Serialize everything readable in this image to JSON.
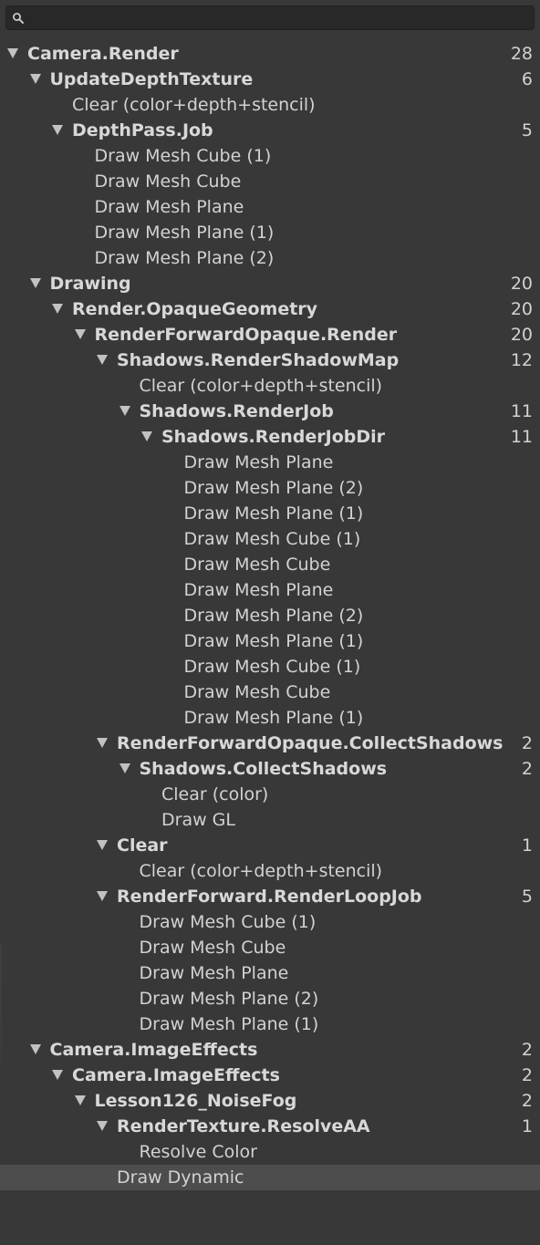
{
  "search": {
    "value": "",
    "placeholder": ""
  },
  "tree": [
    {
      "label": "Camera.Render",
      "count": "28",
      "depth": 0,
      "expandable": true
    },
    {
      "label": "UpdateDepthTexture",
      "count": "6",
      "depth": 1,
      "expandable": true
    },
    {
      "label": "Clear (color+depth+stencil)",
      "count": "",
      "depth": 2,
      "expandable": false
    },
    {
      "label": "DepthPass.Job",
      "count": "5",
      "depth": 2,
      "expandable": true
    },
    {
      "label": "Draw Mesh Cube (1)",
      "count": "",
      "depth": 3,
      "expandable": false
    },
    {
      "label": "Draw Mesh Cube",
      "count": "",
      "depth": 3,
      "expandable": false
    },
    {
      "label": "Draw Mesh Plane",
      "count": "",
      "depth": 3,
      "expandable": false
    },
    {
      "label": "Draw Mesh Plane (1)",
      "count": "",
      "depth": 3,
      "expandable": false
    },
    {
      "label": "Draw Mesh Plane (2)",
      "count": "",
      "depth": 3,
      "expandable": false
    },
    {
      "label": "Drawing",
      "count": "20",
      "depth": 1,
      "expandable": true
    },
    {
      "label": "Render.OpaqueGeometry",
      "count": "20",
      "depth": 2,
      "expandable": true
    },
    {
      "label": "RenderForwardOpaque.Render",
      "count": "20",
      "depth": 3,
      "expandable": true
    },
    {
      "label": "Shadows.RenderShadowMap",
      "count": "12",
      "depth": 4,
      "expandable": true
    },
    {
      "label": "Clear (color+depth+stencil)",
      "count": "",
      "depth": 5,
      "expandable": false
    },
    {
      "label": "Shadows.RenderJob",
      "count": "11",
      "depth": 5,
      "expandable": true
    },
    {
      "label": "Shadows.RenderJobDir",
      "count": "11",
      "depth": 6,
      "expandable": true
    },
    {
      "label": "Draw Mesh Plane",
      "count": "",
      "depth": 7,
      "expandable": false
    },
    {
      "label": "Draw Mesh Plane (2)",
      "count": "",
      "depth": 7,
      "expandable": false
    },
    {
      "label": "Draw Mesh Plane (1)",
      "count": "",
      "depth": 7,
      "expandable": false
    },
    {
      "label": "Draw Mesh Cube (1)",
      "count": "",
      "depth": 7,
      "expandable": false
    },
    {
      "label": "Draw Mesh Cube",
      "count": "",
      "depth": 7,
      "expandable": false
    },
    {
      "label": "Draw Mesh Plane",
      "count": "",
      "depth": 7,
      "expandable": false
    },
    {
      "label": "Draw Mesh Plane (2)",
      "count": "",
      "depth": 7,
      "expandable": false
    },
    {
      "label": "Draw Mesh Plane (1)",
      "count": "",
      "depth": 7,
      "expandable": false
    },
    {
      "label": "Draw Mesh Cube (1)",
      "count": "",
      "depth": 7,
      "expandable": false
    },
    {
      "label": "Draw Mesh Cube",
      "count": "",
      "depth": 7,
      "expandable": false
    },
    {
      "label": "Draw Mesh Plane (1)",
      "count": "",
      "depth": 7,
      "expandable": false
    },
    {
      "label": "RenderForwardOpaque.CollectShadows",
      "count": "2",
      "depth": 4,
      "expandable": true
    },
    {
      "label": "Shadows.CollectShadows",
      "count": "2",
      "depth": 5,
      "expandable": true
    },
    {
      "label": "Clear (color)",
      "count": "",
      "depth": 6,
      "expandable": false
    },
    {
      "label": "Draw GL",
      "count": "",
      "depth": 6,
      "expandable": false
    },
    {
      "label": "Clear",
      "count": "1",
      "depth": 4,
      "expandable": true
    },
    {
      "label": "Clear (color+depth+stencil)",
      "count": "",
      "depth": 5,
      "expandable": false
    },
    {
      "label": "RenderForward.RenderLoopJob",
      "count": "5",
      "depth": 4,
      "expandable": true
    },
    {
      "label": "Draw Mesh Cube (1)",
      "count": "",
      "depth": 5,
      "expandable": false
    },
    {
      "label": "Draw Mesh Cube",
      "count": "",
      "depth": 5,
      "expandable": false
    },
    {
      "label": "Draw Mesh Plane",
      "count": "",
      "depth": 5,
      "expandable": false
    },
    {
      "label": "Draw Mesh Plane (2)",
      "count": "",
      "depth": 5,
      "expandable": false
    },
    {
      "label": "Draw Mesh Plane (1)",
      "count": "",
      "depth": 5,
      "expandable": false
    },
    {
      "label": "Camera.ImageEffects",
      "count": "2",
      "depth": 1,
      "expandable": true
    },
    {
      "label": "Camera.ImageEffects",
      "count": "2",
      "depth": 2,
      "expandable": true
    },
    {
      "label": "Lesson126_NoiseFog",
      "count": "2",
      "depth": 3,
      "expandable": true
    },
    {
      "label": "RenderTexture.ResolveAA",
      "count": "1",
      "depth": 4,
      "expandable": true
    },
    {
      "label": "Resolve Color",
      "count": "",
      "depth": 5,
      "expandable": false
    },
    {
      "label": "Draw Dynamic",
      "count": "",
      "depth": 4,
      "expandable": false,
      "selected": true
    }
  ],
  "colors": {
    "background": "#383838",
    "search_background": "#282828",
    "selected_row": "#4d4d4d",
    "text": "#d2d2d2",
    "arrow": "#c2c2c2"
  },
  "icons": {
    "search": "search-icon",
    "expand": "chevron-down-icon"
  }
}
